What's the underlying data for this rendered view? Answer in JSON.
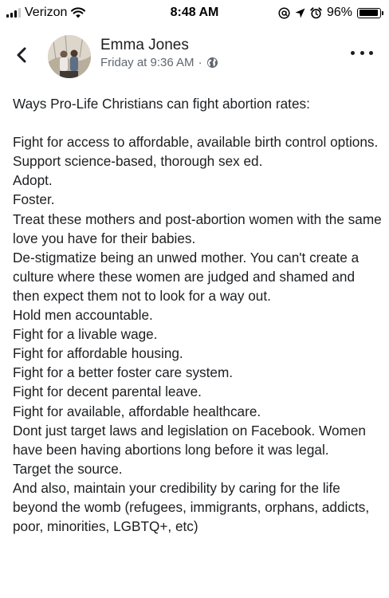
{
  "status_bar": {
    "carrier": "Verizon",
    "time": "8:48 AM",
    "battery": "96%",
    "battery_level": 0.96,
    "icons": [
      "signal-bars-icon",
      "wifi-icon",
      "at-sign-icon",
      "location-arrow-icon",
      "alarm-clock-icon",
      "battery-icon"
    ]
  },
  "post": {
    "author": "Emma Jones",
    "timestamp": "Friday at 9:36 AM",
    "separator": "·",
    "audience_icon": "globe-icon",
    "back_icon": "chevron-left-icon",
    "more_icon": "more-dots-icon",
    "lines": [
      "Ways Pro-Life Christians can fight abortion rates:",
      "",
      "Fight for access to affordable, available birth control options.",
      "Support science-based, thorough sex ed.",
      "Adopt.",
      "Foster.",
      "Treat these mothers and post-abortion women with the same love you have for their babies.",
      "De-stigmatize being an unwed mother. You can't create a culture where these women are judged and shamed and then expect them not to look for a way out.",
      "Hold men accountable.",
      "Fight for a livable wage.",
      "Fight for affordable housing.",
      "Fight for a better foster care system.",
      "Fight for decent parental leave.",
      "Fight for available, affordable healthcare.",
      "Dont just target laws and legislation on Facebook. Women have been having abortions long before it was legal.",
      "Target the source.",
      "And also, maintain your credibility by caring for the life beyond the womb (refugees, immigrants, orphans, addicts, poor, minorities, LGBTQ+, etc)"
    ]
  }
}
